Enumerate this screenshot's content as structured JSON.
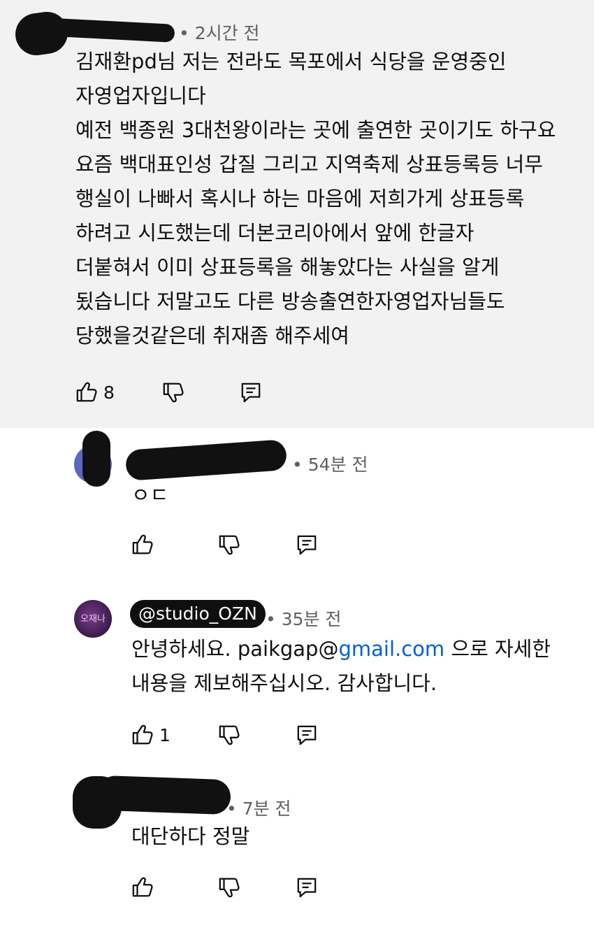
{
  "comments": [
    {
      "meta": "• 2시간 전",
      "text": "김재환pd님 저는 전라도 목포에서 식당을 운영중인\n자영업자입니다\n예전 백종원 3대천왕이라는 곳에 출연한 곳이기도 하구요\n요즘 백대표인성 갑질 그리고 지역축제 상표등록등 너무\n행실이 나빠서 혹시나 하는 마음에 저희가게 상표등록\n하려고 시도했는데 더본코리아에서 앞에 한글자\n더붙혀서 이미 상표등록을 해놓았다는 사실을 알게\n됬습니다 저말고도 다른 방송출연한자영업자님들도\n당했을것같은데 취재좀 해주세여",
      "likes": "8"
    }
  ],
  "replies": [
    {
      "meta": "• 54분 전",
      "text": "ㅇㄷ",
      "likes": ""
    },
    {
      "handle": "@studio_OZN",
      "avatar_text": "오재나",
      "meta": "• 35분 전",
      "text_before": "안녕하세요. paikgap@",
      "link": "gmail.com",
      "text_after": " 으로 자세한\n내용을 제보해주십시오. 감사합니다.",
      "likes": "1"
    },
    {
      "meta": "• 7분 전",
      "text": "대단하다 정말",
      "likes": ""
    }
  ],
  "icons": {
    "like": "thumb-up-icon",
    "dislike": "thumb-down-icon",
    "reply": "reply-icon"
  },
  "colors": {
    "top_background": "#f2f2f2",
    "link": "#065fd4",
    "meta": "#606060",
    "handle_chip": "#0f0f0f"
  }
}
